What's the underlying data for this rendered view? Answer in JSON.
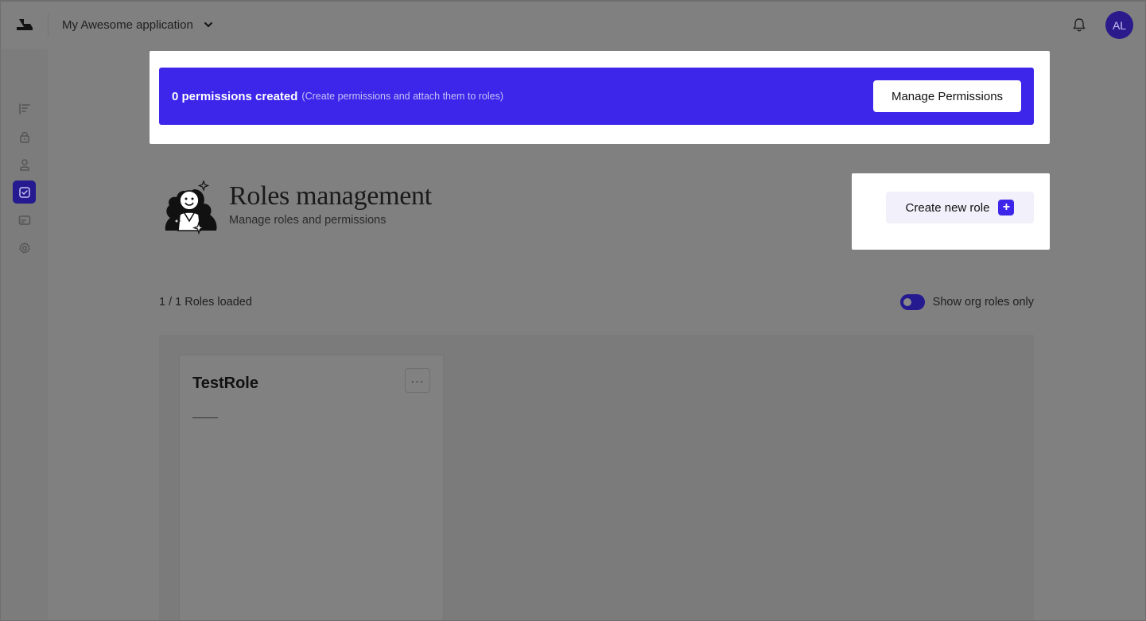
{
  "header": {
    "app_name": "My Awesome application",
    "avatar_initials": "AL"
  },
  "sidebar": {
    "items": [
      {
        "icon": "list-icon"
      },
      {
        "icon": "lock-icon"
      },
      {
        "icon": "user-icon"
      },
      {
        "icon": "check-square-icon",
        "active": true
      },
      {
        "icon": "card-icon"
      },
      {
        "icon": "gear-icon"
      }
    ]
  },
  "banner": {
    "title": "0 permissions created",
    "subtitle": "(Create permissions and attach them to roles)",
    "button_label": "Manage Permissions"
  },
  "page": {
    "title": "Roles management",
    "subtitle": "Manage roles and permissions",
    "create_button_label": "Create new role",
    "create_button_icon": "+"
  },
  "roles": {
    "count_text": "1 / 1 Roles loaded",
    "toggle_label": "Show org roles only",
    "toggle_on": true,
    "items": [
      {
        "name": "TestRole",
        "more_label": "···"
      }
    ]
  },
  "colors": {
    "accent": "#3d25ea",
    "accent_dark": "#251a8f",
    "overlay_bg": "#808080",
    "white": "#ffffff"
  }
}
